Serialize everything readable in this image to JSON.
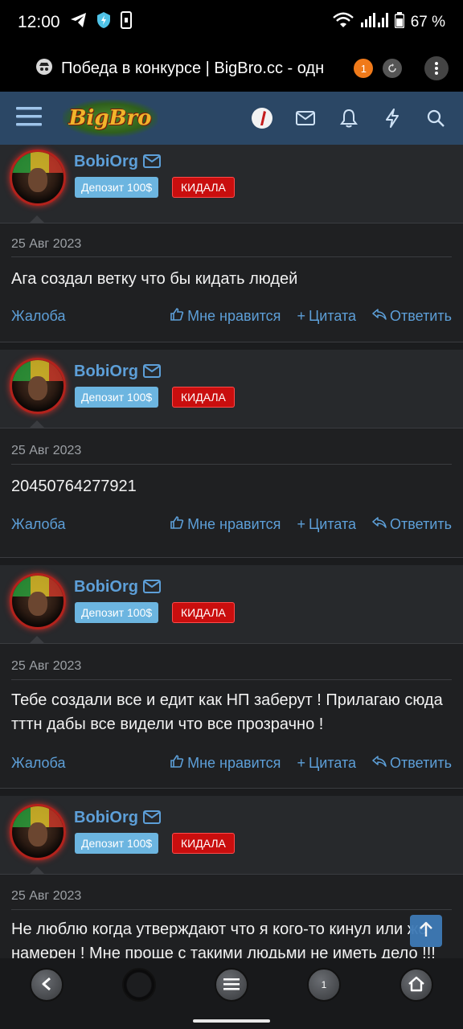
{
  "status_bar": {
    "time": "12:00",
    "battery": "67 %"
  },
  "browser": {
    "title": "Победа в конкурсе | BigBro.cc - одн",
    "tab_count": "1"
  },
  "nav": {
    "logo_text": "BigBro"
  },
  "posts": [
    {
      "username": "BobiOrg",
      "badge_deposit": "Депозит 100$",
      "badge_status": "КИДАЛА",
      "date": "25 Авг 2023",
      "text": "Ага создал ветку что бы кидать людей",
      "report": "Жалоба",
      "like": "Мне нравится",
      "quote": "Цитата",
      "reply": "Ответить"
    },
    {
      "username": "BobiOrg",
      "badge_deposit": "Депозит 100$",
      "badge_status": "КИДАЛА",
      "date": "25 Авг 2023",
      "text": "20450764277921",
      "report": "Жалоба",
      "like": "Мне нравится",
      "quote": "Цитата",
      "reply": "Ответить"
    },
    {
      "username": "BobiOrg",
      "badge_deposit": "Депозит 100$",
      "badge_status": "КИДАЛА",
      "date": "25 Авг 2023",
      "text": "Тебе создали все и едит как НП заберут ! Прилагаю сюда тттн дабы все видели что все прозрачно !",
      "report": "Жалоба",
      "like": "Мне нравится",
      "quote": "Цитата",
      "reply": "Ответить"
    },
    {
      "username": "BobiOrg",
      "badge_deposit": "Депозит 100$",
      "badge_status": "КИДАЛА",
      "date": "25 Авг 2023",
      "text": "Не люблю когда утверждают что я кого-то кинул или же намерен ! Мне проще с такими людьми не иметь дело !!!"
    }
  ],
  "bottom_nav": {
    "tabs_count": "1"
  }
}
